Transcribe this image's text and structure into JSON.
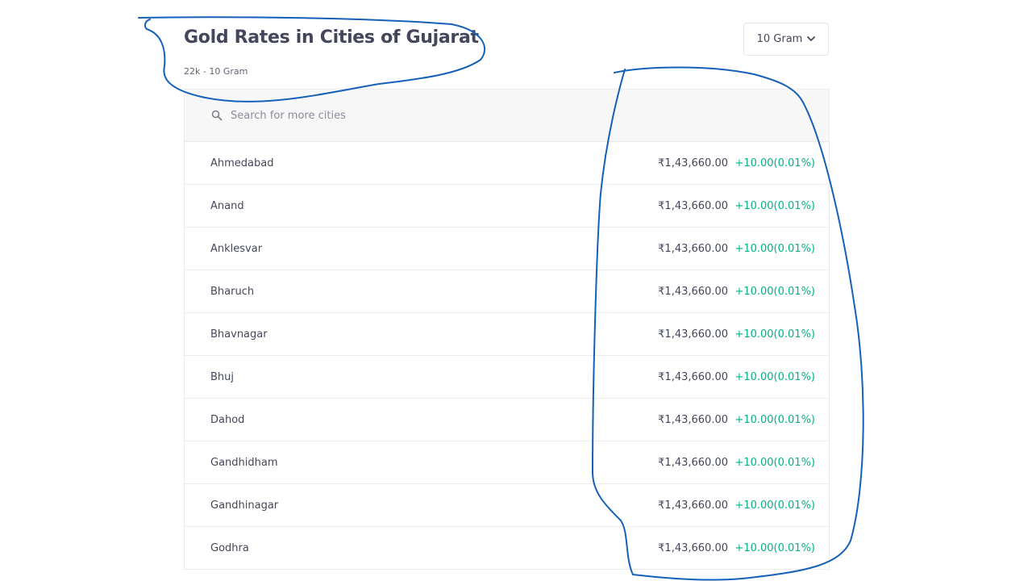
{
  "header": {
    "title": "Gold Rates in Cities of Gujarat",
    "subtitle": "22k - 10 Gram"
  },
  "unit_selector": {
    "selected": "10 Gram",
    "icon": "chevron-down-icon"
  },
  "search": {
    "placeholder": "Search for more cities",
    "value": "",
    "icon": "search-icon"
  },
  "colors": {
    "positive_change": "#00b386",
    "annotation_ink": "#1560b8"
  },
  "cities": [
    {
      "name": "Ahmedabad",
      "price": "₹1,43,660.00",
      "change": "+10.00(0.01%)"
    },
    {
      "name": "Anand",
      "price": "₹1,43,660.00",
      "change": "+10.00(0.01%)"
    },
    {
      "name": "Anklesvar",
      "price": "₹1,43,660.00",
      "change": "+10.00(0.01%)"
    },
    {
      "name": "Bharuch",
      "price": "₹1,43,660.00",
      "change": "+10.00(0.01%)"
    },
    {
      "name": "Bhavnagar",
      "price": "₹1,43,660.00",
      "change": "+10.00(0.01%)"
    },
    {
      "name": "Bhuj",
      "price": "₹1,43,660.00",
      "change": "+10.00(0.01%)"
    },
    {
      "name": "Dahod",
      "price": "₹1,43,660.00",
      "change": "+10.00(0.01%)"
    },
    {
      "name": "Gandhidham",
      "price": "₹1,43,660.00",
      "change": "+10.00(0.01%)"
    },
    {
      "name": "Gandhinagar",
      "price": "₹1,43,660.00",
      "change": "+10.00(0.01%)"
    },
    {
      "name": "Godhra",
      "price": "₹1,43,660.00",
      "change": "+10.00(0.01%)"
    }
  ]
}
